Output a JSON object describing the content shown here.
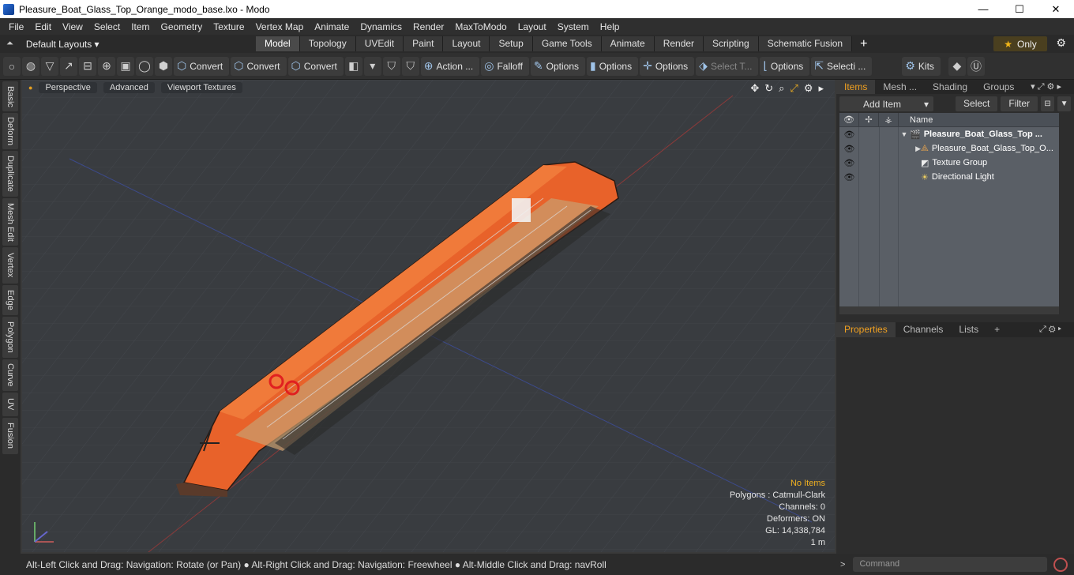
{
  "window": {
    "title": "Pleasure_Boat_Glass_Top_Orange_modo_base.lxo - Modo",
    "min": "—",
    "max": "☐",
    "close": "✕"
  },
  "menu": [
    "File",
    "Edit",
    "View",
    "Select",
    "Item",
    "Geometry",
    "Texture",
    "Vertex Map",
    "Animate",
    "Dynamics",
    "Render",
    "MaxToModo",
    "Layout",
    "System",
    "Help"
  ],
  "layouts": {
    "label": "Default Layouts ▾",
    "tabs": [
      "Model",
      "Topology",
      "UVEdit",
      "Paint",
      "Layout",
      "Setup",
      "Game Tools",
      "Animate",
      "Render",
      "Scripting",
      "Schematic Fusion"
    ],
    "active_tab": "Model",
    "add": "+",
    "only_label": "Only"
  },
  "toolbar": {
    "convert1": "Convert",
    "convert2": "Convert",
    "convert3": "Convert",
    "action": "Action ...",
    "falloff": "Falloff",
    "options1": "Options",
    "options2": "Options",
    "options3": "Options",
    "select_t": "Select T...",
    "options4": "Options",
    "selecti": "Selecti ...",
    "kits": "Kits"
  },
  "sidetabs": [
    "Basic",
    "Deform",
    "Duplicate",
    "Mesh Edit",
    "Vertex",
    "Edge",
    "Polygon",
    "Curve",
    "UV",
    "Fusion"
  ],
  "viewport": {
    "perspective": "Perspective",
    "advanced": "Advanced",
    "viewport_textures": "Viewport Textures",
    "info": {
      "no_items": "No Items",
      "polygons": "Polygons : Catmull-Clark",
      "channels": "Channels: 0",
      "deformers": "Deformers: ON",
      "gl": "GL: 14,338,784",
      "scale": "1 m"
    }
  },
  "items_panel": {
    "tabs": [
      "Items",
      "Mesh ...",
      "Shading",
      "Groups"
    ],
    "add_item": "Add Item",
    "select": "Select",
    "filter": "Filter",
    "name_header": "Name",
    "rows": [
      {
        "label": "Pleasure_Boat_Glass_Top ...",
        "icon": "scene-icon"
      },
      {
        "label": "Pleasure_Boat_Glass_Top_O...",
        "icon": "mesh-icon"
      },
      {
        "label": "Texture Group",
        "icon": "texture-icon"
      },
      {
        "label": "Directional Light",
        "icon": "light-icon"
      }
    ]
  },
  "properties_panel": {
    "tabs": [
      "Properties",
      "Channels",
      "Lists"
    ],
    "add": "+"
  },
  "status": {
    "hint": "Alt-Left Click and Drag: Navigation: Rotate (or Pan) ● Alt-Right Click and Drag: Navigation: Freewheel ● Alt-Middle Click and Drag: navRoll",
    "command_placeholder": "Command"
  }
}
